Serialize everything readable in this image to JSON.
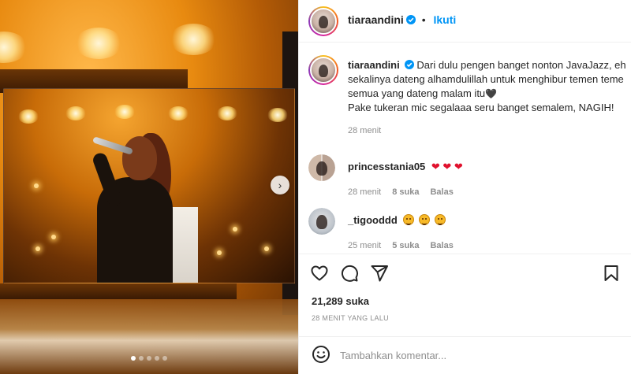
{
  "post": {
    "author": "tiaraandini",
    "follow_label": "Ikuti",
    "separator": "•"
  },
  "caption": {
    "username": "tiaraandini",
    "line1": "Dari dulu pengen banget nonton JavaJazz, eh",
    "line2": "sekalinya dateng alhamdulillah untuk menghibur temen teme",
    "line3": "semua yang dateng malam itu",
    "line4": "Pake tukeran mic segalaaa seru banget semalem, NAGIH!",
    "time": "28 menit"
  },
  "comments": [
    {
      "username": "princesstania05",
      "emoji": "❤ ❤ ❤",
      "time": "28 menit",
      "likes": "8 suka",
      "reply": "Balas"
    },
    {
      "username": "_tigooddd",
      "time": "25 menit",
      "likes": "5 suka",
      "reply": "Balas"
    }
  ],
  "stats": {
    "likes": "21,289 suka",
    "posted": "28 MENIT YANG LALU"
  },
  "comment_box": {
    "placeholder": "Tambahkan komentar..."
  },
  "carousel": {
    "next_glyph": "›",
    "slides": 5,
    "active_index": 0
  },
  "icons": {
    "like": "heart-icon",
    "comment": "comment-bubble-icon",
    "share": "paper-plane-icon",
    "save": "bookmark-icon",
    "emoji": "smiley-icon",
    "verified": "verified-badge-icon"
  },
  "colors": {
    "accent": "#0095f6",
    "heart_red": "#e0122e",
    "muted": "#8e8e8e"
  }
}
